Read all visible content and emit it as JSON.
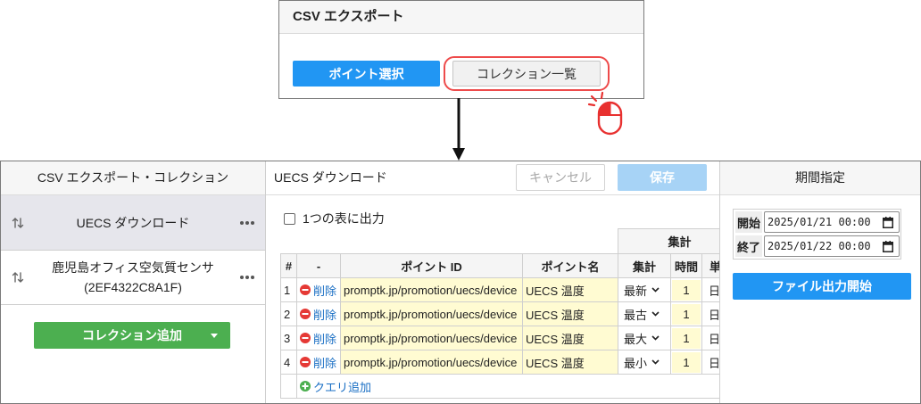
{
  "colors": {
    "primary_blue": "#2196f3",
    "save_disabled_blue": "#a7d3f6",
    "add_green": "#4caf50",
    "delete_red": "#e53935",
    "highlight_red": "#ee4b4b",
    "editable_yellow": "#fffbd2",
    "link_blue": "#1a6fc4",
    "selected_item": "#e6e6ec"
  },
  "icons": {
    "click": "mouse-click-icon",
    "flow": "arrow-down-icon",
    "reorder": "sort-arrows-icon",
    "menu": "more-dots-icon",
    "dropdown": "caret-down-icon",
    "delete": "minus-circle-icon",
    "add": "plus-circle-icon",
    "select": "chevron-down-icon",
    "date": "calendar-icon"
  },
  "export_dialog": {
    "title": "CSV エクスポート",
    "point_select_label": "ポイント選択",
    "collection_list_label": "コレクション一覧"
  },
  "collection_panel": {
    "title": "CSV エクスポート・コレクション",
    "items": [
      {
        "name": "UECS ダウンロード",
        "selected": true
      },
      {
        "name": "鹿児島オフィス空気質センサ",
        "id": "(2EF4322C8A1F)",
        "selected": false
      }
    ],
    "add_button_label": "コレクション追加"
  },
  "query_panel": {
    "title": "UECS ダウンロード",
    "cancel_label": "キャンセル",
    "save_label": "保存",
    "single_table_label": "1つの表に出力",
    "single_table_checked": false,
    "table": {
      "group_header": "集計",
      "columns": {
        "index": "#",
        "action": "-",
        "point_id": "ポイント ID",
        "point_name": "ポイント名",
        "aggregate": "集計",
        "time": "時間",
        "unit": "単"
      },
      "rows": [
        {
          "index": "1",
          "delete_label": "削除",
          "point_id": "promptk.jp/promotion/uecs/device",
          "point_name": "UECS 温度",
          "aggregate": "最新",
          "time": "1",
          "unit": "日"
        },
        {
          "index": "2",
          "delete_label": "削除",
          "point_id": "promptk.jp/promotion/uecs/device",
          "point_name": "UECS 温度",
          "aggregate": "最古",
          "time": "1",
          "unit": "日"
        },
        {
          "index": "3",
          "delete_label": "削除",
          "point_id": "promptk.jp/promotion/uecs/device",
          "point_name": "UECS 温度",
          "aggregate": "最大",
          "time": "1",
          "unit": "日"
        },
        {
          "index": "4",
          "delete_label": "削除",
          "point_id": "promptk.jp/promotion/uecs/device",
          "point_name": "UECS 温度",
          "aggregate": "最小",
          "time": "1",
          "unit": "日"
        }
      ]
    },
    "add_query_label": "クエリ追加"
  },
  "period_panel": {
    "title": "期間指定",
    "start_label": "開始",
    "start_value": "2025/01/21 00:00",
    "end_label": "終了",
    "end_value": "2025/01/22 00:00",
    "export_button_label": "ファイル出力開始"
  }
}
